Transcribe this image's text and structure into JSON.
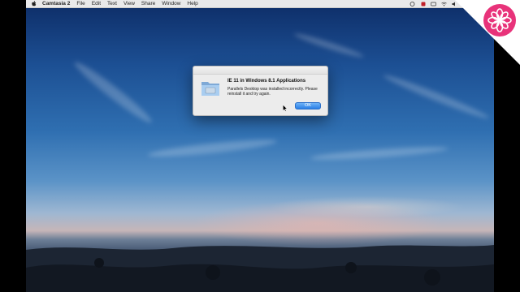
{
  "menubar": {
    "items": [
      "Camtasia 2",
      "File",
      "Edit",
      "Text",
      "View",
      "Share",
      "Window",
      "Help"
    ]
  },
  "dialog": {
    "title": "IE 11 in Windows 8.1 Applications",
    "message": "Parallels Desktop was installed incorrectly. Please reinstall it and try again.",
    "ok_label": "OK"
  },
  "colors": {
    "badge": "#e8337a",
    "ok_button": "#2a7fe6",
    "record_indicator": "#c0202a"
  },
  "icons": [
    "apple-icon",
    "folder-icon",
    "wifi-icon",
    "record-icon",
    "search-icon",
    "list-icon",
    "flower-logo-icon"
  ]
}
